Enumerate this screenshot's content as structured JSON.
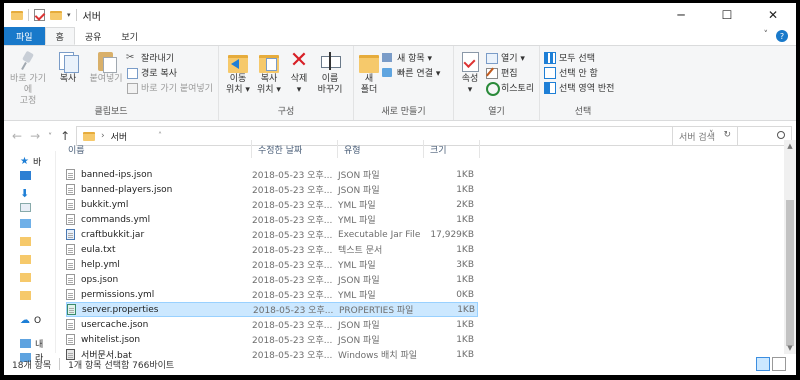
{
  "window": {
    "title": "서버",
    "minimize_glyph": "─",
    "maximize_glyph": "☐",
    "close_glyph": "✕"
  },
  "tabs": [
    {
      "label": "파일"
    },
    {
      "label": "홈"
    },
    {
      "label": "공유"
    },
    {
      "label": "보기"
    }
  ],
  "ribbon": {
    "clipboard": {
      "group_label": "클립보드",
      "pin": "바로 가기에\n고정",
      "copy": "복사",
      "paste": "붙여넣기",
      "cut": "잘라내기",
      "copy_path": "경로 복사",
      "paste_shortcut": "바로 가기 붙여넣기"
    },
    "organize": {
      "group_label": "구성",
      "move_to": "이동\n위치 ▾",
      "copy_to": "복사\n위치 ▾",
      "delete": "삭제\n▾",
      "rename": "이름\n바꾸기"
    },
    "new": {
      "group_label": "새로 만들기",
      "new_folder": "새\n폴더",
      "new_item": "새 항목 ▾",
      "easy_access": "빠른 연결 ▾"
    },
    "open": {
      "group_label": "열기",
      "properties": "속성\n▾",
      "open": "열기 ▾",
      "edit": "편집",
      "history": "히스토리"
    },
    "select": {
      "group_label": "선택",
      "select_all": "모두 선택",
      "select_none": "선택 안 함",
      "invert": "선택 영역 반전"
    }
  },
  "address": {
    "path": "서버",
    "search_placeholder": "서버 검색"
  },
  "navpane": {
    "items": [
      {
        "label": "바"
      },
      {
        "label": "O"
      },
      {
        "label": "내"
      },
      {
        "label": "라"
      }
    ]
  },
  "columns": {
    "name": "이름",
    "date": "수정한 날짜",
    "type": "유형",
    "size": "크기"
  },
  "files": [
    {
      "name": "banned-ips.json",
      "date": "2018-05-23 오후...",
      "type": "JSON 파일",
      "size": "1KB",
      "kind": "txt"
    },
    {
      "name": "banned-players.json",
      "date": "2018-05-23 오후...",
      "type": "JSON 파일",
      "size": "1KB",
      "kind": "txt"
    },
    {
      "name": "bukkit.yml",
      "date": "2018-05-23 오후...",
      "type": "YML 파일",
      "size": "2KB",
      "kind": "txt"
    },
    {
      "name": "commands.yml",
      "date": "2018-05-23 오후...",
      "type": "YML 파일",
      "size": "1KB",
      "kind": "txt"
    },
    {
      "name": "craftbukkit.jar",
      "date": "2018-05-23 오후...",
      "type": "Executable Jar File",
      "size": "17,929KB",
      "kind": "jar"
    },
    {
      "name": "eula.txt",
      "date": "2018-05-23 오후...",
      "type": "텍스트 문서",
      "size": "1KB",
      "kind": "txt"
    },
    {
      "name": "help.yml",
      "date": "2018-05-23 오후...",
      "type": "YML 파일",
      "size": "3KB",
      "kind": "txt"
    },
    {
      "name": "ops.json",
      "date": "2018-05-23 오후...",
      "type": "JSON 파일",
      "size": "1KB",
      "kind": "txt"
    },
    {
      "name": "permissions.yml",
      "date": "2018-05-23 오후...",
      "type": "YML 파일",
      "size": "0KB",
      "kind": "txt"
    },
    {
      "name": "server.properties",
      "date": "2018-05-23 오후...",
      "type": "PROPERTIES 파일",
      "size": "1KB",
      "kind": "props",
      "selected": true
    },
    {
      "name": "usercache.json",
      "date": "2018-05-23 오후...",
      "type": "JSON 파일",
      "size": "1KB",
      "kind": "txt"
    },
    {
      "name": "whitelist.json",
      "date": "2018-05-23 오후...",
      "type": "JSON 파일",
      "size": "1KB",
      "kind": "txt"
    },
    {
      "name": "서버문서.bat",
      "date": "2018-05-23 오후...",
      "type": "Windows 배치 파일",
      "size": "1KB",
      "kind": "bat"
    }
  ],
  "status": {
    "count": "18개 항목",
    "selection": "1개 항목 선택함 766바이트"
  },
  "colors": {
    "accent": "#1979ca",
    "selection": "#cce8ff"
  }
}
